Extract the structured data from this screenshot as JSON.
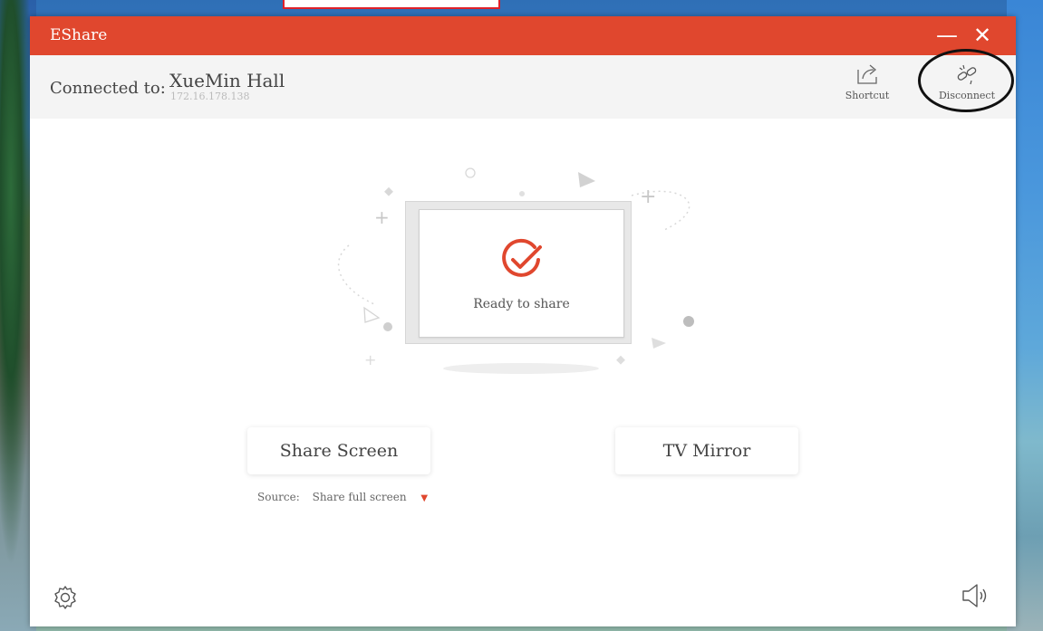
{
  "window": {
    "title": "EShare",
    "minimize_glyph": "—",
    "close_glyph": "✕",
    "accent_color": "#e0472e"
  },
  "connection": {
    "label": "Connected to:",
    "name": "XueMin Hall",
    "ip": "172.16.178.138"
  },
  "toolbar": {
    "shortcut_label": "Shortcut",
    "disconnect_label": "Disconnect"
  },
  "status": {
    "text": "Ready to share"
  },
  "actions": {
    "share_screen": "Share Screen",
    "tv_mirror": "TV Mirror"
  },
  "source": {
    "label": "Source:",
    "value": "Share full screen"
  },
  "icons": {
    "shortcut": "share-arrow-icon",
    "disconnect": "broken-link-icon",
    "status": "check-circle-icon",
    "settings": "gear-icon",
    "volume": "speaker-icon"
  }
}
